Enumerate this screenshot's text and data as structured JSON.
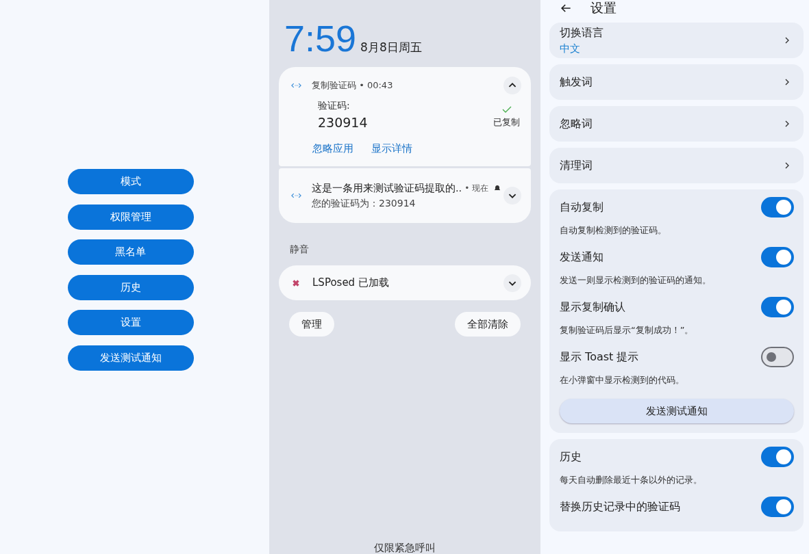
{
  "main_menu": {
    "buttons": [
      "模式",
      "权限管理",
      "黑名单",
      "历史",
      "设置",
      "发送测试通知"
    ]
  },
  "lock_screen": {
    "time": "7:59",
    "date": "8月8日周五",
    "notifications": [
      {
        "kind": "expanded",
        "app": "复制验证码 • 00:43",
        "label": "验证码:",
        "code": "230914",
        "status": "已复制",
        "actions": [
          "忽略应用",
          "显示详情"
        ]
      },
      {
        "kind": "collapsed",
        "title": "这是一条用来测试验证码提取的..",
        "meta": "• 现在",
        "body": "您的验证码为：230914"
      }
    ],
    "silent_header": "静音",
    "silent_notifications": [
      {
        "title": "LSPosed 已加载"
      }
    ],
    "buttons": [
      "管理",
      "全部清除"
    ],
    "footer": "仅限紧急呼叫"
  },
  "settings": {
    "title": "设置",
    "links": [
      {
        "label": "切换语言",
        "value": "中文"
      },
      {
        "label": "触发词"
      },
      {
        "label": "忽略词"
      },
      {
        "label": "清理词"
      }
    ],
    "groups": [
      {
        "items": [
          {
            "label": "自动复制",
            "description": "自动复制检测到的验证码。",
            "on": true
          },
          {
            "label": "发送通知",
            "description": "发送一则显示检测到的验证码的通知。",
            "on": true
          },
          {
            "label": "显示复制确认",
            "description": "复制验证码后显示“复制成功！”。",
            "on": true
          },
          {
            "label": "显示 Toast 提示",
            "description": "在小弹窗中显示检测到的代码。",
            "on": false
          }
        ],
        "button": "发送测试通知"
      },
      {
        "items": [
          {
            "label": "历史",
            "description": "每天自动删除最近十条以外的记录。",
            "on": true
          },
          {
            "label": "替换历史记录中的验证码",
            "on": true
          }
        ]
      }
    ]
  }
}
